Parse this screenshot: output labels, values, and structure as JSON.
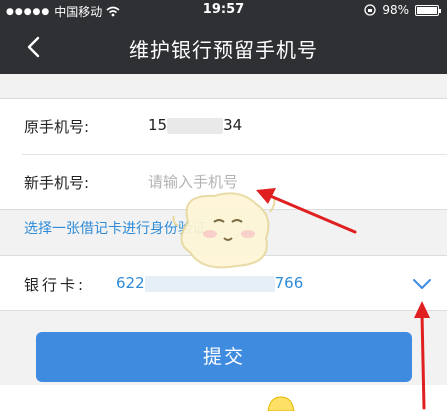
{
  "status_bar": {
    "carrier": "中国移动",
    "time": "19:57",
    "battery_level": 0.98,
    "battery_text": "98%",
    "icons": [
      "signal-dots-icon",
      "wifi-icon",
      "rotation-lock-icon",
      "battery-icon"
    ]
  },
  "navbar": {
    "title": "维护银行预留手机号",
    "back_icon": "chevron-left-icon"
  },
  "form": {
    "original_phone_label": "原手机号:",
    "original_phone_prefix": "15",
    "original_phone_suffix": "34",
    "new_phone_label": "新手机号:",
    "new_phone_placeholder": "请输入手机号",
    "new_phone_value": ""
  },
  "debit_link": "选择一张借记卡进行身份验证",
  "bank_card": {
    "label": "银行卡:",
    "number_prefix": "622",
    "number_suffix": "766",
    "dropdown_icon": "chevron-down-icon"
  },
  "submit_label": "提交",
  "colors": {
    "navbar": "#2f3033",
    "accent": "#3f8be0",
    "link": "#2f8bd8",
    "annotation_arrow": "#e02020"
  }
}
